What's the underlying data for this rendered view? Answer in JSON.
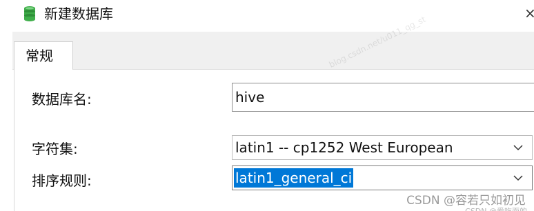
{
  "window": {
    "title": "新建数据库",
    "close_glyph": "×",
    "icon": "database-icon"
  },
  "tabs": [
    {
      "label": "常规",
      "active": true
    }
  ],
  "form": {
    "db_name": {
      "label": "数据库名:",
      "value": "hive"
    },
    "charset": {
      "label": "字符集:",
      "value": "latin1 -- cp1252 West European"
    },
    "collation": {
      "label": "排序规则:",
      "value": "latin1_general_ci"
    }
  },
  "watermark": {
    "faint_text": "blog.csdn.net/u011_qg_st",
    "csdn_text": "CSDN @容若只如初见",
    "csdn_sub": "CSDN @爱吃面的"
  },
  "colors": {
    "selection": "#0078d7",
    "tabstrip": "#f0f0f0",
    "db_icon": "#3fae4a"
  }
}
